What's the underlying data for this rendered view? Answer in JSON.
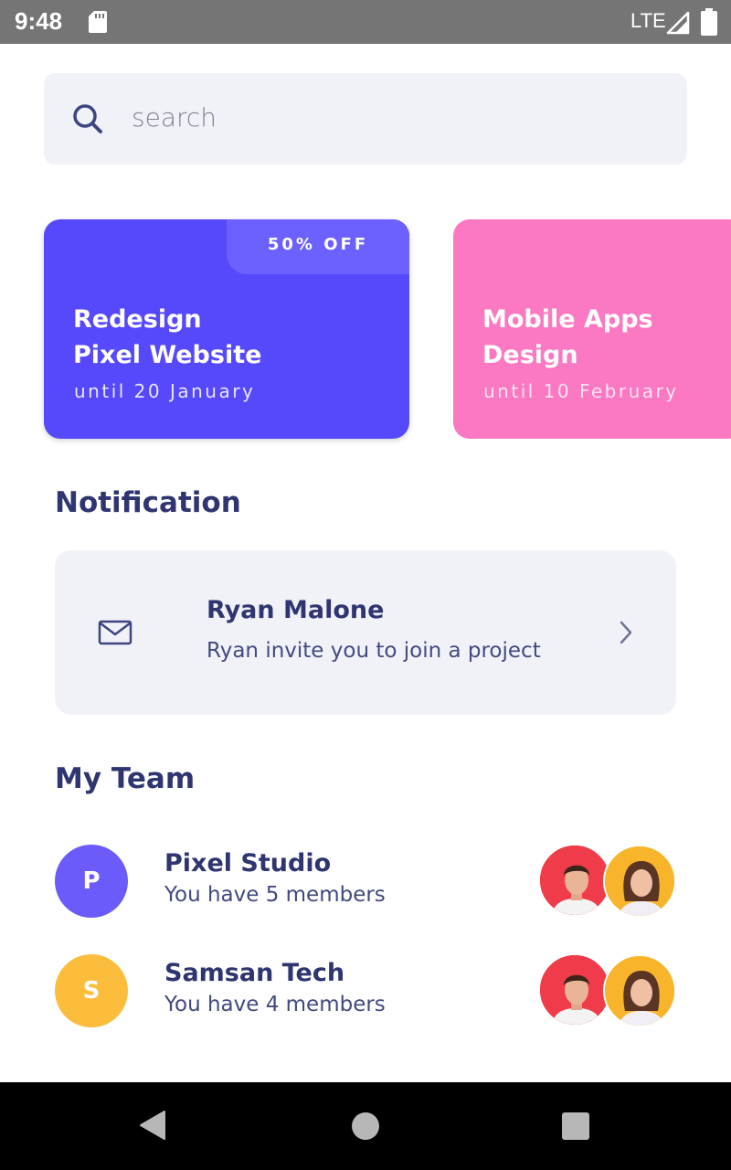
{
  "status_bar": {
    "time": "9:48",
    "network": "LTE"
  },
  "search": {
    "placeholder": "search"
  },
  "cards": [
    {
      "badge": "50% OFF",
      "title_line1": "Redesign",
      "title_line2": "Pixel Website",
      "date": "until 20 January",
      "color": "#5648fb"
    },
    {
      "title_line1": "Mobile Apps",
      "title_line2": "Design",
      "date": "until 10 February",
      "color": "#fb78c2"
    }
  ],
  "notification": {
    "heading": "Notification",
    "name": "Ryan Malone",
    "message": "Ryan invite you to join a project",
    "icon": "mail-icon"
  },
  "team": {
    "heading": "My Team",
    "items": [
      {
        "initial": "P",
        "name": "Pixel Studio",
        "members": "You have 5 members",
        "color": "#6b5bfb"
      },
      {
        "initial": "S",
        "name": "Samsan Tech",
        "members": "You have 4 members",
        "color": "#fbbd3b"
      }
    ]
  },
  "colors": {
    "accent": "#5648fb",
    "pink": "#fb78c2",
    "text_dark": "#2f3570",
    "surface": "#f1f2f7",
    "member_red": "#ef3b4a",
    "member_yellow": "#f8b42a"
  }
}
